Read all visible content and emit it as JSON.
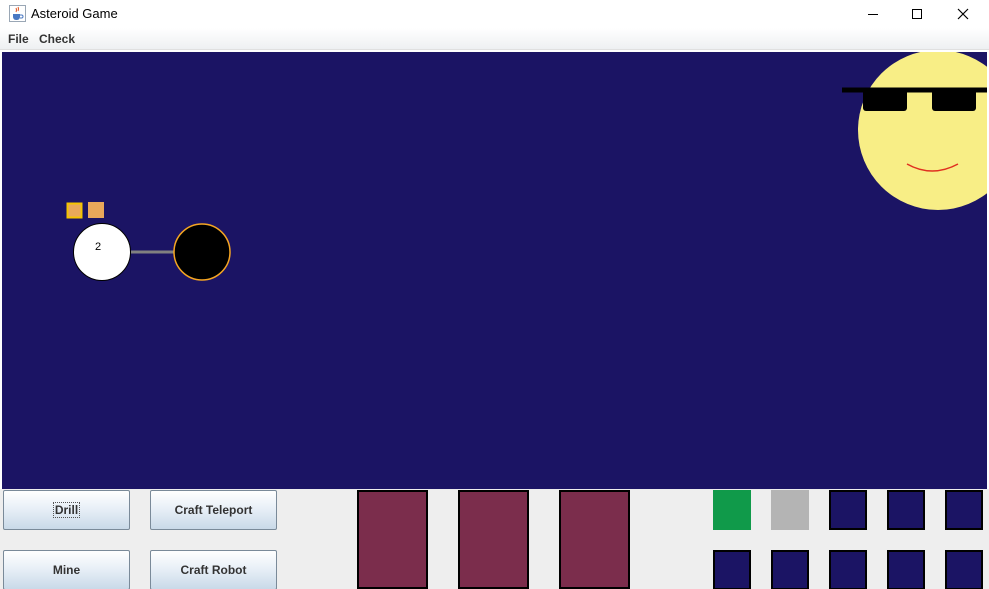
{
  "window": {
    "title": "Asteroid Game",
    "icon": "java-cup-icon"
  },
  "menu": {
    "items": [
      "File",
      "Check"
    ]
  },
  "game": {
    "background_color": "#1b1464",
    "asteroid": {
      "label": "2",
      "fill": "#ffffff"
    },
    "black_asteroid": {
      "fill": "#000000",
      "outline": "#f5a623"
    },
    "link_color": "#808080",
    "markers": [
      {
        "color": "#e9a85a",
        "outline": "#f5c400"
      },
      {
        "color": "#e9a85a"
      }
    ],
    "sun": {
      "fill": "#f8ee86",
      "glasses": "#000000",
      "smile": "#e03020"
    }
  },
  "actions": {
    "drill": "Drill",
    "craft_teleport": "Craft Teleport",
    "mine": "Mine",
    "craft_robot": "Craft Robot"
  },
  "resource_slots": {
    "count": 3,
    "color": "#7b2d4c"
  },
  "inventory": {
    "row1": [
      "#109a4a",
      "#b4b4b4",
      "#1b1464",
      "#1b1464",
      "#1b1464"
    ],
    "row2": [
      "#1b1464",
      "#1b1464",
      "#1b1464",
      "#1b1464",
      "#1b1464"
    ]
  }
}
